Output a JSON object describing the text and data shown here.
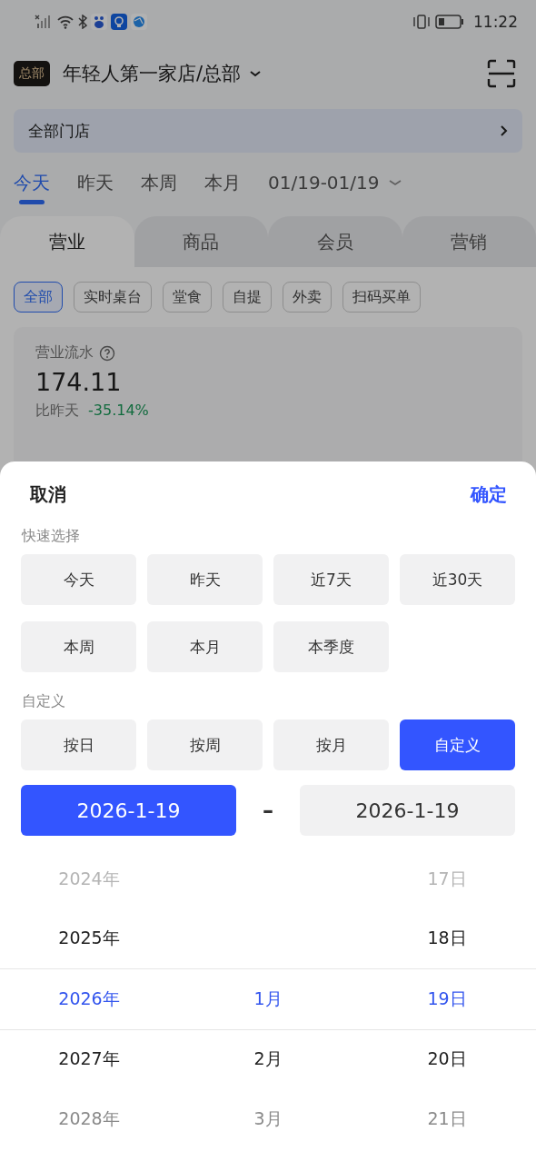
{
  "status_bar": {
    "time": "11:22"
  },
  "header": {
    "badge": "总部",
    "title": "年轻人第一家店/总部"
  },
  "store_selector": {
    "label": "全部门店"
  },
  "period_tabs": [
    {
      "label": "今天",
      "selected": true
    },
    {
      "label": "昨天",
      "selected": false
    },
    {
      "label": "本周",
      "selected": false
    },
    {
      "label": "本月",
      "selected": false
    }
  ],
  "date_range": "01/19-01/19",
  "category_tabs": [
    {
      "label": "营业",
      "selected": true
    },
    {
      "label": "商品",
      "selected": false
    },
    {
      "label": "会员",
      "selected": false
    },
    {
      "label": "营销",
      "selected": false
    }
  ],
  "filter_chips": [
    {
      "label": "全部",
      "selected": true
    },
    {
      "label": "实时桌台",
      "selected": false
    },
    {
      "label": "堂食",
      "selected": false
    },
    {
      "label": "自提",
      "selected": false
    },
    {
      "label": "外卖",
      "selected": false
    },
    {
      "label": "扫码买单",
      "selected": false
    }
  ],
  "metric": {
    "label": "营业流水",
    "value": "174.11",
    "compare_label": "比昨天",
    "change": "-35.14%"
  },
  "sheet": {
    "cancel": "取消",
    "confirm": "确定",
    "quick_title": "快速选择",
    "quick_options": [
      {
        "label": "今天",
        "selected": false
      },
      {
        "label": "昨天",
        "selected": false
      },
      {
        "label": "近7天",
        "selected": false
      },
      {
        "label": "近30天",
        "selected": false
      },
      {
        "label": "本周",
        "selected": false
      },
      {
        "label": "本月",
        "selected": false
      },
      {
        "label": "本季度",
        "selected": false
      }
    ],
    "custom_title": "自定义",
    "modes": [
      {
        "label": "按日",
        "selected": false
      },
      {
        "label": "按周",
        "selected": false
      },
      {
        "label": "按月",
        "selected": false
      },
      {
        "label": "自定义",
        "selected": true
      }
    ],
    "start_date": {
      "value": "2026-1-19",
      "selected": true
    },
    "dash": "–",
    "end_date": {
      "value": "2026-1-19",
      "selected": false
    },
    "picker_rows": [
      {
        "kind": "far",
        "year": "2024年",
        "day": "17日"
      },
      {
        "kind": "near",
        "year": "2025年",
        "day": "18日"
      },
      {
        "kind": "selected",
        "year": "2026年",
        "month": "1月",
        "day": "19日"
      },
      {
        "kind": "near",
        "year": "2027年",
        "month": "2月",
        "day": "20日"
      },
      {
        "kind": "mid",
        "year": "2028年",
        "month": "3月",
        "day": "21日"
      }
    ]
  }
}
